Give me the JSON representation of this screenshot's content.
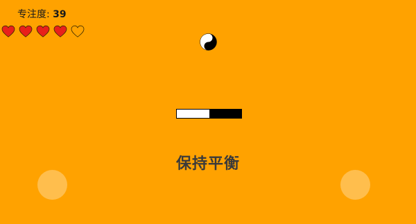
{
  "hud": {
    "focus_label": "专注度:",
    "focus_value": "39"
  },
  "lives": {
    "max": 5,
    "current": 4,
    "filled_color": "#E8201B",
    "empty_color": "#FFA200",
    "outline_color": "#3a2a00"
  },
  "center_icon": "yin-yang-icon",
  "balance": {
    "white_fraction": 0.5
  },
  "status_text": "保持平衡",
  "colors": {
    "background": "#FFA200"
  },
  "controls": {
    "left_button": "left-touch-button",
    "right_button": "right-touch-button"
  }
}
